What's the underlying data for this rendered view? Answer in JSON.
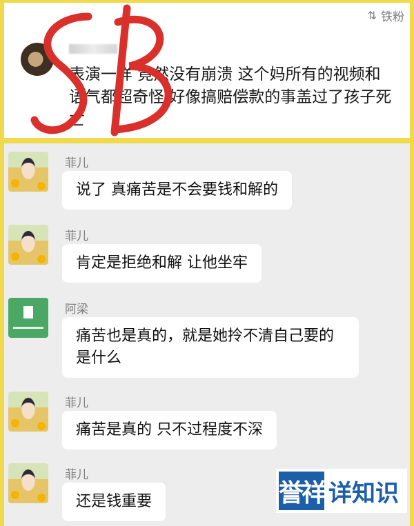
{
  "top": {
    "follow_label": "铁粉",
    "comment_text": "表演一样 竟然没有崩溃 这个妈所有的视频和语气都超奇怪 好像搞赔偿款的事盖过了孩子死亡",
    "scribble_text": "SB"
  },
  "chat": [
    {
      "sender": "菲儿",
      "avatar": "girl-avatar",
      "text": "说了 真痛苦是不会要钱和解的"
    },
    {
      "sender": "菲儿",
      "avatar": "girl-avatar",
      "text": "肯定是拒绝和解 让他坐牢"
    },
    {
      "sender": "阿梁",
      "avatar": "app-avatar",
      "text": "痛苦也是真的，就是她拎不清自己要的是什么"
    },
    {
      "sender": "菲儿",
      "avatar": "girl-avatar",
      "text": "痛苦是真的 只不过程度不深"
    },
    {
      "sender": "菲儿",
      "avatar": "girl-avatar",
      "text": "还是钱重要"
    }
  ],
  "watermark": {
    "text": "详知识"
  },
  "colors": {
    "frame": "#f0d94a",
    "chat_bg": "#ededed",
    "scribble": "#d9302b",
    "brand": "#1d5ea8"
  }
}
